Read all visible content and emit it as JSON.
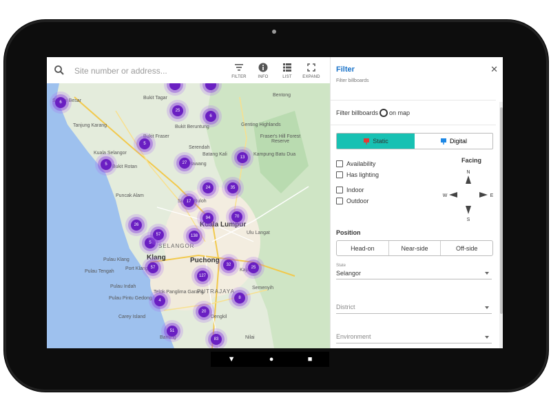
{
  "search": {
    "placeholder": "Site number or address..."
  },
  "toolbar": {
    "filter": "FILTER",
    "info": "INFO",
    "list": "LIST",
    "expand": "EXPAND"
  },
  "map": {
    "places": [
      {
        "name": "Sungai Besar"
      },
      {
        "name": "Bukit Tagar"
      },
      {
        "name": "Bentong"
      },
      {
        "name": "Tanjung Karang"
      },
      {
        "name": "Serendah"
      },
      {
        "name": "Genting Highlands"
      },
      {
        "name": "Kuala Selangor"
      },
      {
        "name": "Bukit Rotan"
      },
      {
        "name": "Rawang"
      },
      {
        "name": "Bukit Beruntung"
      },
      {
        "name": "Batang Kali"
      },
      {
        "name": "Bukit Fraser"
      },
      {
        "name": "Kampung Batu Dua"
      },
      {
        "name": "Puncak Alam"
      },
      {
        "name": "Sungai Buloh"
      },
      {
        "name": "Kuala Lumpur",
        "big": true
      },
      {
        "name": "Ulu Langat"
      },
      {
        "name": "SELANGOR",
        "state": true
      },
      {
        "name": "Klang",
        "big": true
      },
      {
        "name": "Port Klang"
      },
      {
        "name": "Pulau Klang"
      },
      {
        "name": "Pulau Tengah"
      },
      {
        "name": "Pulau Indah"
      },
      {
        "name": "Pulau Pintu Gedong"
      },
      {
        "name": "Puchong"
      },
      {
        "name": "Kajang"
      },
      {
        "name": "PUTRAJAYA",
        "state": true
      },
      {
        "name": "Semenyih"
      },
      {
        "name": "Telok Panglima Garang"
      },
      {
        "name": "Carey Island"
      },
      {
        "name": "Dengkil"
      },
      {
        "name": "Nilai"
      },
      {
        "name": "Banting"
      },
      {
        "name": "Fraser's Hill Forest Reserve"
      }
    ],
    "clusters": [
      "6",
      "",
      "",
      "25",
      "6",
      "5",
      "27",
      "13",
      "5",
      "24",
      "35",
      "17",
      "26",
      "94",
      "5",
      "70",
      "57",
      "138",
      "57",
      "32",
      "25",
      "127",
      "8",
      "4",
      "20",
      "51",
      "83"
    ]
  },
  "panel": {
    "title": "Filter",
    "subtitle": "Filter billboards",
    "filter_on_map_prefix": "Filter billboards",
    "filter_on_map_suffix": "on map",
    "types": [
      {
        "label": "Static",
        "active": true
      },
      {
        "label": "Digital",
        "active": false
      }
    ],
    "checks": [
      "Availability",
      "Has lighting",
      "Indoor",
      "Outdoor"
    ],
    "facing": {
      "title": "Facing",
      "n": "N",
      "e": "E",
      "s": "S",
      "w": "W"
    },
    "position": {
      "title": "Position",
      "options": [
        "Head-on",
        "Near-side",
        "Off-side"
      ]
    },
    "state": {
      "label": "State",
      "value": "Selangor"
    },
    "district": {
      "placeholder": "District"
    },
    "environment": {
      "placeholder": "Environment"
    }
  },
  "colors": {
    "accent": "#18c1b3",
    "title_blue": "#1a73c9",
    "cluster": "#6a1fc2"
  }
}
